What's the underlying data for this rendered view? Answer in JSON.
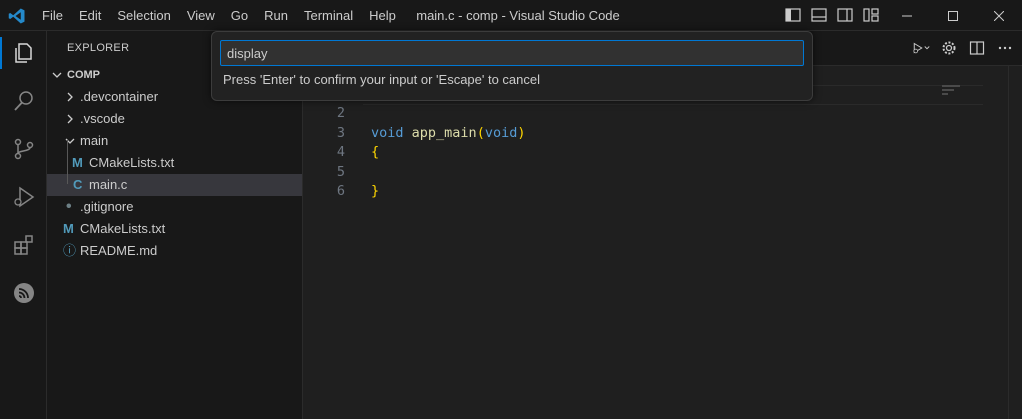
{
  "titlebar": {
    "menu": [
      "File",
      "Edit",
      "Selection",
      "View",
      "Go",
      "Run",
      "Terminal",
      "Help"
    ],
    "window_title": "main.c - comp - Visual Studio Code"
  },
  "sidebar": {
    "title": "EXPLORER",
    "tree": [
      {
        "label": "COMP",
        "kind": "root-folder",
        "expanded": true
      },
      {
        "label": ".devcontainer",
        "kind": "folder",
        "expanded": false
      },
      {
        "label": ".vscode",
        "kind": "folder",
        "expanded": false
      },
      {
        "label": "main",
        "kind": "folder",
        "expanded": true
      },
      {
        "label": "CMakeLists.txt",
        "kind": "cmake-file",
        "icon_text": "M"
      },
      {
        "label": "main.c",
        "kind": "c-file",
        "icon_text": "C",
        "selected": true
      },
      {
        "label": ".gitignore",
        "kind": "gitignore-file"
      },
      {
        "label": "CMakeLists.txt",
        "kind": "cmake-file",
        "icon_text": "M"
      },
      {
        "label": "README.md",
        "kind": "readme-file",
        "icon_text": "ⓘ"
      }
    ]
  },
  "editor": {
    "line_numbers": [
      "2",
      "3",
      "4",
      "5",
      "6"
    ],
    "code": {
      "l3_kw1": "void",
      "l3_fn": "app_main",
      "l3_kw2": "void",
      "l4": "{",
      "l6": "}"
    }
  },
  "quick_input": {
    "value": "display",
    "message": "Press 'Enter' to confirm your input or 'Escape' to cancel"
  },
  "colors": {
    "accent": "#0078d4",
    "keyword": "#569cd6",
    "function": "#dcdcaa",
    "bracket": "#ffd700",
    "c_icon": "#519aba",
    "cmake_icon": "#519aba"
  }
}
